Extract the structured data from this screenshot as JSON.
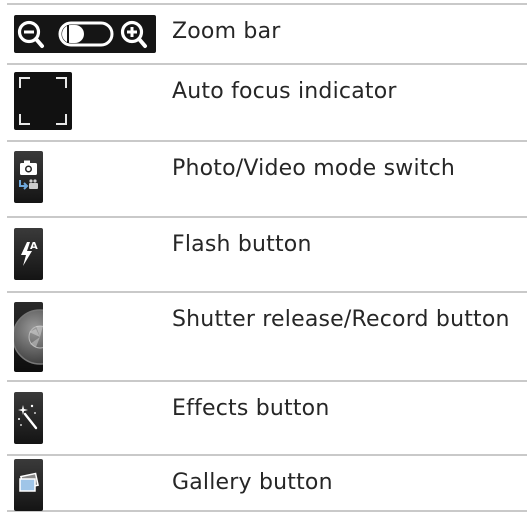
{
  "rows": [
    {
      "label": "Zoom bar",
      "icon": "zoom-bar-icon"
    },
    {
      "label": "Auto focus indicator",
      "icon": "focus-frame-icon"
    },
    {
      "label": "Photo/Video mode switch",
      "icon": "camera-mode-switch-icon"
    },
    {
      "label": "Flash button",
      "icon": "flash-auto-icon"
    },
    {
      "label": "Shutter release/Record button",
      "icon": "shutter-icon"
    },
    {
      "label": "Effects button",
      "icon": "magic-wand-icon"
    },
    {
      "label": "Gallery button",
      "icon": "gallery-photos-icon"
    }
  ],
  "colors": {
    "border": "#c9c9c9",
    "text": "#262626",
    "icon_bg": "#151515"
  }
}
